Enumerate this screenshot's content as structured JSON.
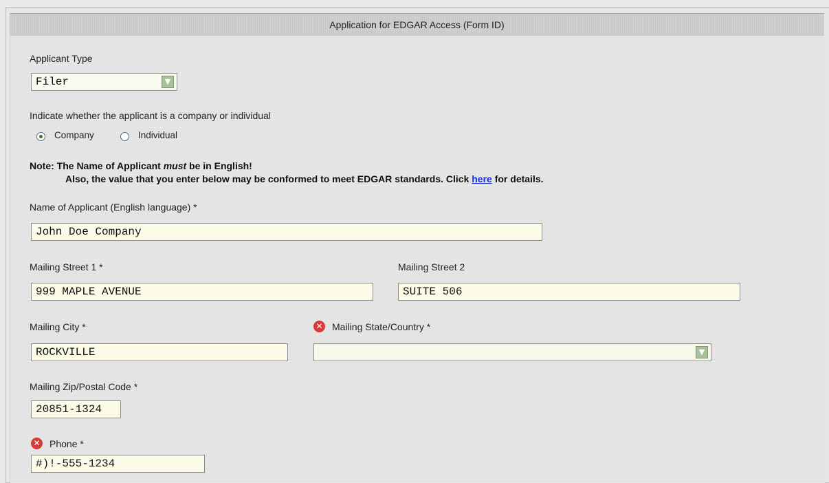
{
  "form": {
    "title": "Application for EDGAR Access (Form ID)",
    "applicant_type": {
      "label": "Applicant Type",
      "value": "Filer"
    },
    "entity_question": "Indicate whether the applicant is a company or individual",
    "radio_company": "Company",
    "radio_individual": "Individual",
    "note": {
      "prefix": "Note:  The Name of Applicant ",
      "emph": "must",
      "suffix": " be in English!",
      "line2_prefix": "Also, the value that you enter below may be conformed to meet EDGAR standards. Click ",
      "link": "here",
      "line2_suffix": " for details."
    },
    "name_label": "Name of Applicant (English language) *",
    "name_value": "John Doe Company",
    "street1_label": "Mailing Street 1 *",
    "street1_value": "999 MAPLE AVENUE",
    "street2_label": "Mailing Street 2",
    "street2_value": "SUITE 506",
    "city_label": "Mailing City *",
    "city_value": "ROCKVILLE",
    "state_label": "Mailing State/Country *",
    "state_value": "",
    "zip_label": "Mailing Zip/Postal Code *",
    "zip_value": "20851-1324",
    "phone_label": "Phone *",
    "phone_value": "#)!-555-1234"
  },
  "icons": {
    "error": "error-x-icon",
    "dropdown": "chevron-down-icon"
  },
  "colors": {
    "link": "#1a2fd8",
    "error": "#d83a3a",
    "field_bg": "#fbfbe8"
  }
}
